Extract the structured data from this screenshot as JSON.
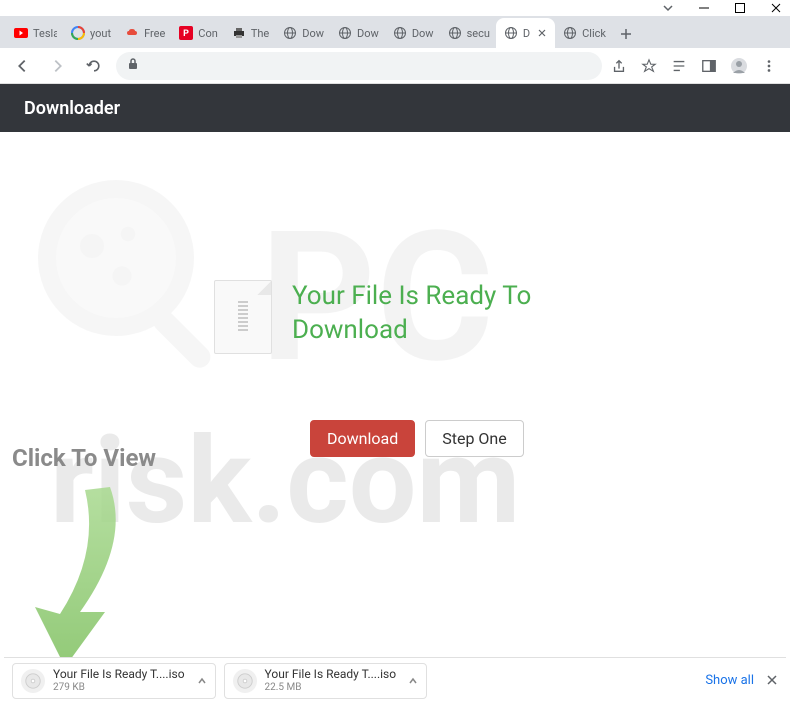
{
  "window": {
    "tabs": [
      {
        "favicon": "youtube",
        "title": "Tesla"
      },
      {
        "favicon": "google",
        "title": "yout"
      },
      {
        "favicon": "cloud-red",
        "title": "Free"
      },
      {
        "favicon": "pinterest",
        "title": "Con"
      },
      {
        "favicon": "printer",
        "title": "The"
      },
      {
        "favicon": "globe",
        "title": "Dow"
      },
      {
        "favicon": "globe",
        "title": "Dow"
      },
      {
        "favicon": "globe",
        "title": "Dow"
      },
      {
        "favicon": "globe",
        "title": "secu"
      },
      {
        "favicon": "globe",
        "title": "D",
        "active": true
      },
      {
        "favicon": "globe",
        "title": "Click"
      }
    ]
  },
  "page": {
    "header_title": "Downloader",
    "message": "Your File Is Ready To Download",
    "download_button": "Download",
    "step_button": "Step One",
    "click_to_view": "Click To View",
    "watermark_domain": "risk.com",
    "watermark_brand": "PC"
  },
  "downloads": {
    "items": [
      {
        "name": "Your File Is Ready T....iso",
        "size": "279 KB"
      },
      {
        "name": "Your File Is Ready T....iso",
        "size": "22.5 MB"
      }
    ],
    "show_all": "Show all"
  }
}
